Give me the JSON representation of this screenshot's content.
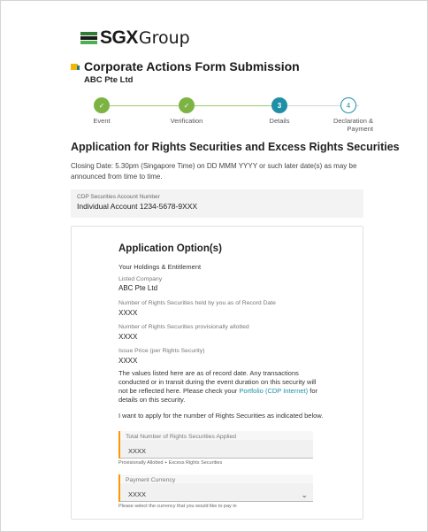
{
  "brand": {
    "logo_bold": "SGX",
    "logo_light": "Group"
  },
  "header": {
    "title": "Corporate Actions Form Submission",
    "company": "ABC Pte Ltd"
  },
  "stepper": {
    "steps": [
      {
        "number": "✓",
        "label": "Event",
        "state": "done"
      },
      {
        "number": "✓",
        "label": "Verification",
        "state": "done"
      },
      {
        "number": "3",
        "label": "Details",
        "state": "current"
      },
      {
        "number": "4",
        "label": "Declaration &\nPayment",
        "state": "todo"
      }
    ]
  },
  "section": {
    "title": "Application for Rights Securities and Excess Rights Securities",
    "closing": "Closing Date: 5.30pm (Singapore Time) on DD MMM YYYY or such later date(s) as may be announced from time to time."
  },
  "cdp": {
    "label": "CDP Securities Account Number",
    "value": "Individual Account 1234-5678-9XXX"
  },
  "options": {
    "title": "Application Option(s)",
    "holdings": "Your Holdings & Entitlement",
    "fields": [
      {
        "label": "Listed Company",
        "value": "ABC Pte Ltd"
      },
      {
        "label": "Number of Rights Securities held by you as of Record Date",
        "value": "XXXX"
      },
      {
        "label": "Number of Rights Securities provisionally allotted",
        "value": "XXXX"
      },
      {
        "label": "Issue Price (per Rights Security)",
        "value": "XXXX"
      }
    ],
    "note_pre": "The values listed here are as of record date. Any transactions conducted or in transit during the event duration on this security will not be reflected here. Please check your ",
    "note_link": "Portfolio (CDP Internet)",
    "note_post": " for details on this security.",
    "apply_text": "I want to apply for the number of Rights Securities as indicated below.",
    "total_field": {
      "label": "Total Number of Rights Securities Applied",
      "value": "XXXX",
      "help": "Provisionally Allotted + Excess Rights Securities"
    },
    "currency_field": {
      "label": "Payment Currency",
      "value": "XXXX",
      "help": "Please select the currency that you would like to pay in"
    }
  },
  "colors": {
    "brand_green": "#2e7d32",
    "accent_teal": "#1f8fa6",
    "done_green": "#7cb342",
    "input_accent": "#ff9800"
  }
}
